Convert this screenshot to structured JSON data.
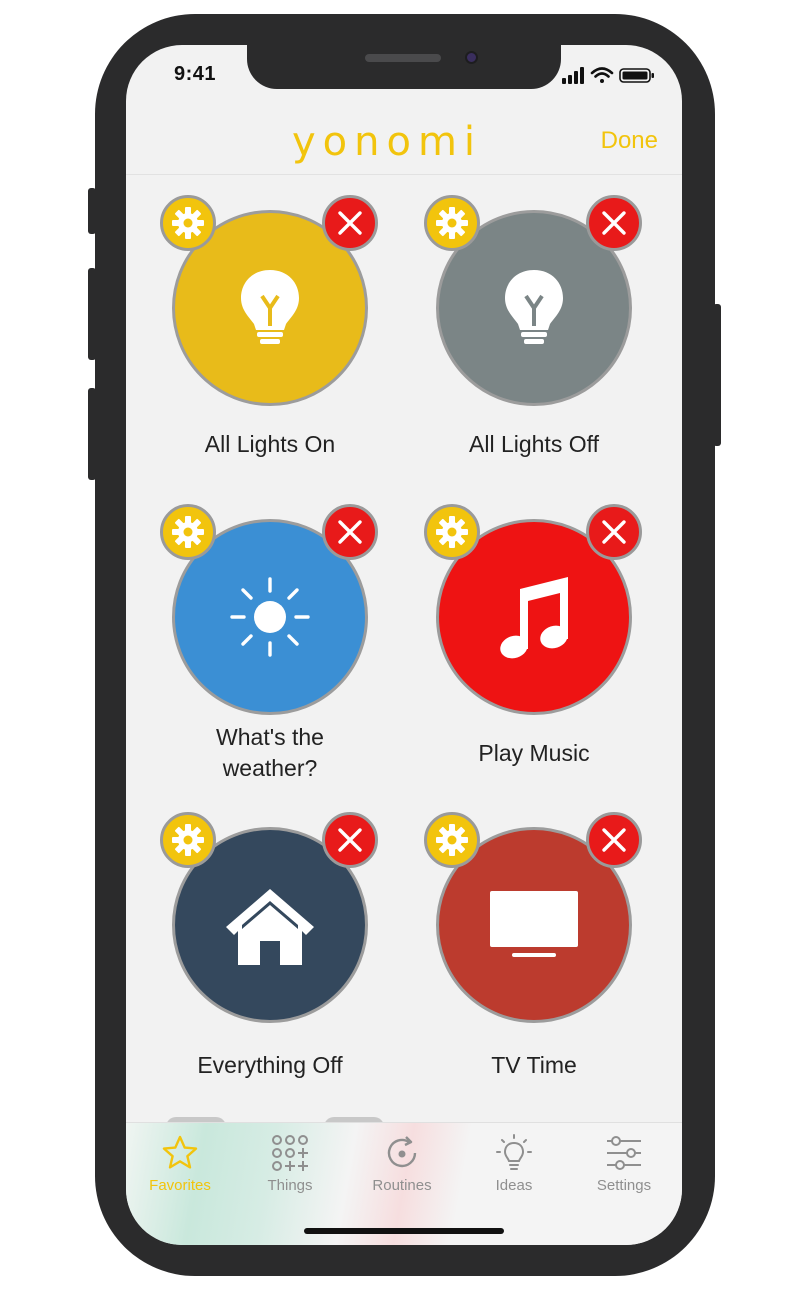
{
  "status": {
    "time": "9:41"
  },
  "header": {
    "logo": "yonomi",
    "done_label": "Done"
  },
  "favorites": [
    {
      "label": "All Lights On",
      "color": "#e8bb1a",
      "icon": "lightbulb-icon"
    },
    {
      "label": "All Lights Off",
      "color": "#7b8586",
      "icon": "lightbulb-icon"
    },
    {
      "label": "What's the weather?",
      "color": "#3b8fd4",
      "icon": "sun-icon"
    },
    {
      "label": "Play Music",
      "color": "#ee1313",
      "icon": "music-note-icon"
    },
    {
      "label": "Everything Off",
      "color": "#34485d",
      "icon": "house-icon"
    },
    {
      "label": "TV Time",
      "color": "#bc3b2e",
      "icon": "tv-icon"
    }
  ],
  "tabs": [
    {
      "label": "Favorites",
      "icon": "star-icon",
      "active": true
    },
    {
      "label": "Things",
      "icon": "things-grid-icon",
      "active": false
    },
    {
      "label": "Routines",
      "icon": "routines-icon",
      "active": false
    },
    {
      "label": "Ideas",
      "icon": "lightbulb-icon",
      "active": false
    },
    {
      "label": "Settings",
      "icon": "sliders-icon",
      "active": false
    }
  ],
  "colors": {
    "accent": "#f2c40d",
    "delete": "#e81a1a"
  }
}
